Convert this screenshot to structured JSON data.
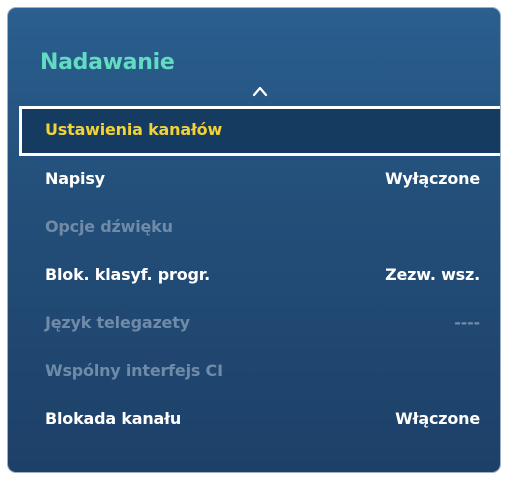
{
  "window": {
    "title": "Nadawanie"
  },
  "menu": {
    "items": [
      {
        "label": "Ustawienia kanałów",
        "value": "",
        "state": "selected"
      },
      {
        "label": "Napisy",
        "value": "Wyłączone",
        "state": "enabled"
      },
      {
        "label": "Opcje dźwięku",
        "value": "",
        "state": "disabled"
      },
      {
        "label": "Blok. klasyf. progr.",
        "value": "Zezw. wsz.",
        "state": "enabled"
      },
      {
        "label": "Język telegazety",
        "value": "----",
        "state": "disabled"
      },
      {
        "label": "Wspólny interfejs CI",
        "value": "",
        "state": "disabled"
      },
      {
        "label": "Blokada kanału",
        "value": "Włączone",
        "state": "enabled"
      }
    ]
  },
  "colors": {
    "title": "#61dcc0",
    "selected_label": "#f2d234",
    "enabled_text": "#ffffff",
    "disabled_text": "#6f8ba8",
    "panel_bg": "#234f7a"
  },
  "icons": {
    "scroll_up": "chevron-up-icon"
  }
}
